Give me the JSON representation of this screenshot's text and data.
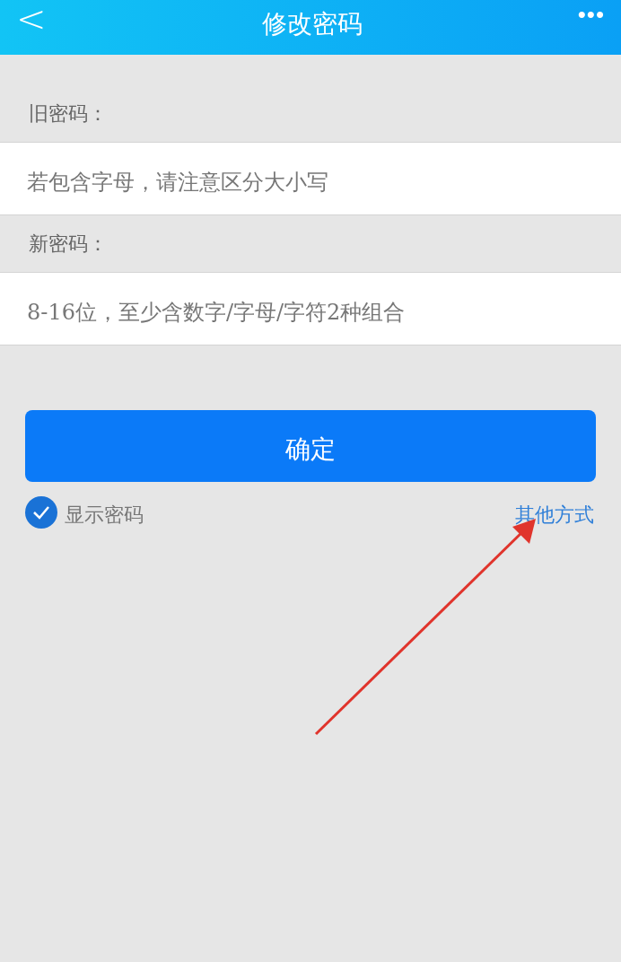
{
  "header": {
    "back": "<",
    "title": "修改密码",
    "more": "•••"
  },
  "fields": [
    {
      "label": "旧密码：",
      "placeholder": "若包含字母，请注意区分大小写"
    },
    {
      "label": "新密码：",
      "placeholder": "8-16位，至少含数字/字母/字符2种组合"
    }
  ],
  "submit": "确定",
  "show_password": {
    "label": "显示密码",
    "checked": true
  },
  "other_link": "其他方式"
}
